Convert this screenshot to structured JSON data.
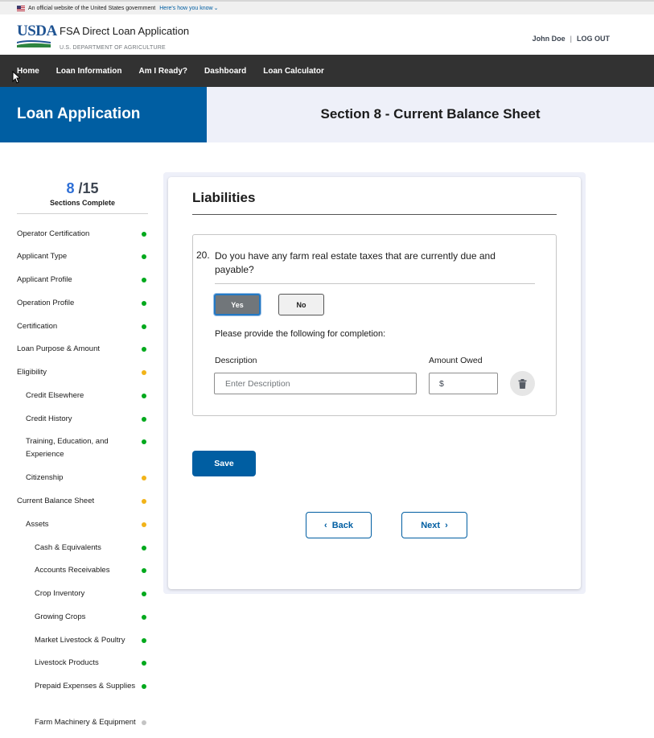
{
  "gov_banner": {
    "text": "An official website of the United States government",
    "link": "Here's how you know"
  },
  "header": {
    "logo_text": "USDA",
    "app_title": "FSA Direct Loan Application",
    "department": "U.S. DEPARTMENT OF AGRICULTURE",
    "user_name": "John Doe",
    "separator": "|",
    "logout": "LOG OUT"
  },
  "nav": {
    "items": [
      {
        "label": "Home"
      },
      {
        "label": "Loan Information"
      },
      {
        "label": "Am I Ready?"
      },
      {
        "label": "Dashboard"
      },
      {
        "label": "Loan Calculator"
      }
    ]
  },
  "title_band": {
    "left": "Loan Application",
    "right": "Section 8 - Current Balance Sheet"
  },
  "progress": {
    "completed": "8",
    "total": "/15",
    "label": "Sections Complete"
  },
  "sidebar": {
    "items": [
      {
        "label": "Operator Certification",
        "status": "complete",
        "level": 0
      },
      {
        "label": "Applicant Type",
        "status": "complete",
        "level": 0
      },
      {
        "label": "Applicant Profile",
        "status": "complete",
        "level": 0
      },
      {
        "label": "Operation Profile",
        "status": "complete",
        "level": 0
      },
      {
        "label": "Certification",
        "status": "complete",
        "level": 0
      },
      {
        "label": "Loan Purpose & Amount",
        "status": "complete",
        "level": 0
      },
      {
        "label": "Eligibility",
        "status": "in-progress",
        "level": 0
      },
      {
        "label": "Credit Elsewhere",
        "status": "complete",
        "level": 1
      },
      {
        "label": "Credit History",
        "status": "complete",
        "level": 1
      },
      {
        "label": "Training, Education, and Experience",
        "status": "complete",
        "level": 1
      },
      {
        "label": "Citizenship",
        "status": "in-progress",
        "level": 1
      },
      {
        "label": "Current Balance Sheet",
        "status": "in-progress",
        "level": 0
      },
      {
        "label": "Assets",
        "status": "in-progress",
        "level": 1
      },
      {
        "label": "Cash & Equivalents",
        "status": "complete",
        "level": 2
      },
      {
        "label": "Accounts Receivables",
        "status": "complete",
        "level": 2
      },
      {
        "label": "Crop Inventory",
        "status": "complete",
        "level": 2
      },
      {
        "label": "Growing Crops",
        "status": "complete",
        "level": 2
      },
      {
        "label": "Market Livestock & Poultry",
        "status": "complete",
        "level": 2
      },
      {
        "label": "Livestock Products",
        "status": "complete",
        "level": 2
      },
      {
        "label": "Prepaid Expenses & Supplies",
        "status": "complete",
        "level": 2
      },
      {
        "label": "Farm Machinery & Equipment",
        "status": "not-started",
        "level": 2
      }
    ]
  },
  "status_colors": {
    "complete": "#00a91c",
    "in-progress": "#f2b318",
    "not-started": "#c4c4c4"
  },
  "main": {
    "section_title": "Liabilities",
    "question_number": "20.",
    "question_text": "Do you have any farm real estate taxes that are currently due and payable?",
    "yes_label": "Yes",
    "no_label": "No",
    "selected_answer": "Yes",
    "provide_text": "Please provide the following for completion:",
    "description_label": "Description",
    "description_placeholder": "Enter Description",
    "amount_label": "Amount Owed",
    "amount_placeholder": "$",
    "save_label": "Save",
    "back_label": "Back",
    "next_label": "Next"
  },
  "icons": {
    "trash": "trash-icon",
    "back": "chevron-left-icon",
    "next": "chevron-right-icon",
    "flag": "us-flag-icon",
    "banner_chevron": "chevron-down-icon"
  }
}
